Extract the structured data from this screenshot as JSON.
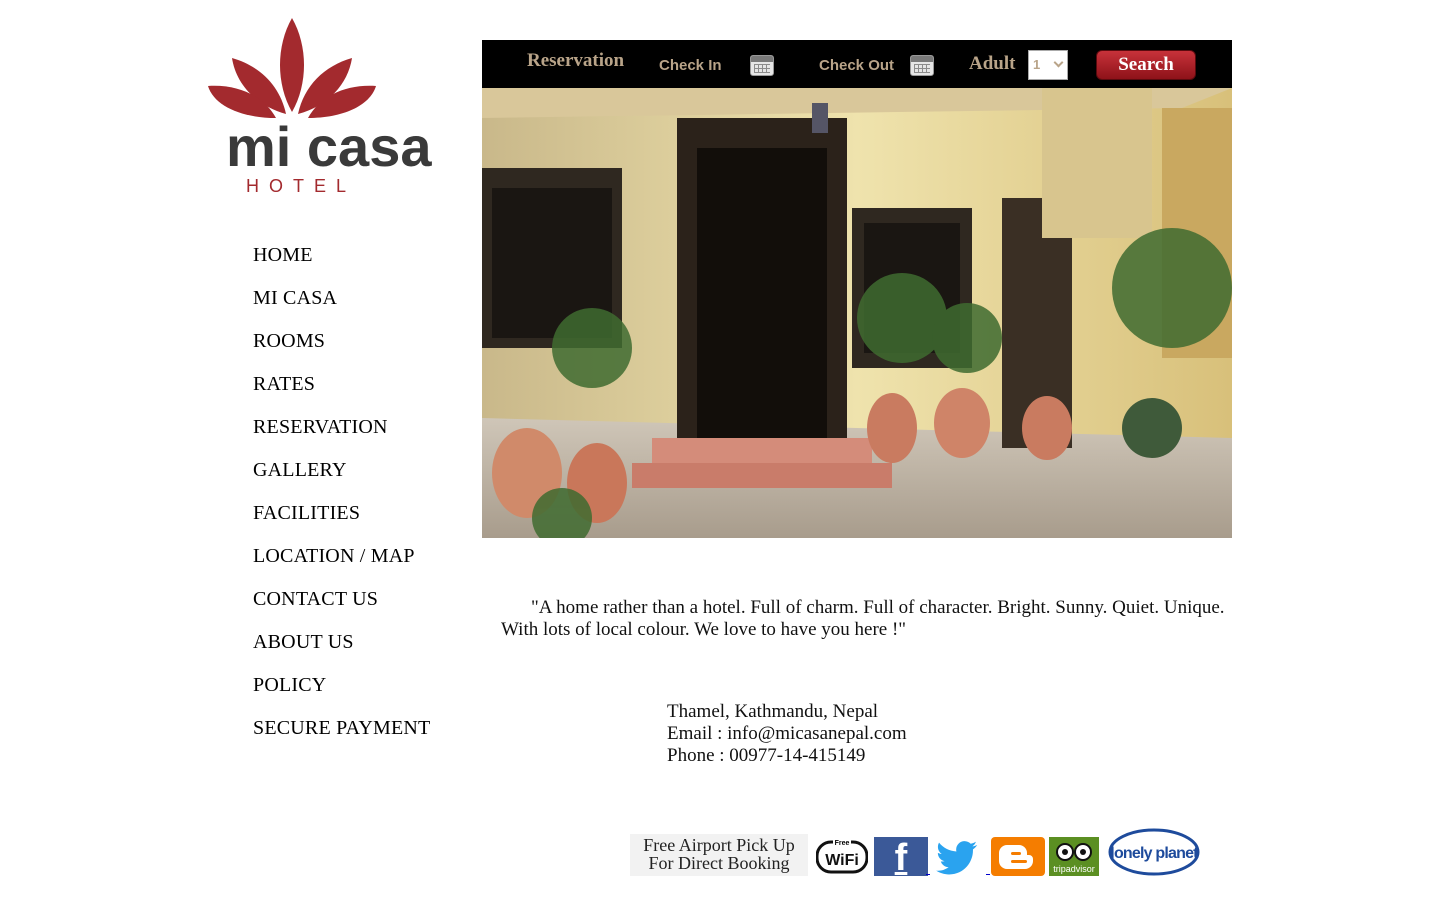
{
  "logo": {
    "word": "mi casa",
    "sub": "HOTEL",
    "brand_color": "#a32a2e"
  },
  "nav": {
    "items": [
      {
        "label": "HOME"
      },
      {
        "label": "MI CASA"
      },
      {
        "label": "ROOMS"
      },
      {
        "label": "RATES"
      },
      {
        "label": "RESERVATION"
      },
      {
        "label": "GALLERY"
      },
      {
        "label": "FACILITIES"
      },
      {
        "label": "LOCATION / MAP"
      },
      {
        "label": "CONTACT US"
      },
      {
        "label": "ABOUT US"
      },
      {
        "label": "POLICY"
      },
      {
        "label": "SECURE PAYMENT"
      }
    ]
  },
  "reservation": {
    "title": "Reservation",
    "check_in_label": "Check In",
    "check_out_label": "Check Out",
    "adult_label": "Adult",
    "adult_value": "1",
    "search_label": "Search",
    "label_color": "#b9a489",
    "button_color": "#b3222b"
  },
  "quote": {
    "text": "\"A home rather than a hotel. Full of charm. Full of character. Bright. Sunny. Quiet. Unique. With lots of local colour. We love to have you here !\""
  },
  "address": {
    "location": "Thamel, Kathmandu, Nepal",
    "email": "Email : info@micasanepal.com",
    "phone": "Phone : 00977-14-415149"
  },
  "badges": {
    "airport_line1": "Free Airport Pick Up",
    "airport_line2": "For Direct Booking",
    "wifi_top": "Free",
    "wifi": "WiFi",
    "facebook": "f",
    "tripadvisor": "tripadvisor",
    "lonely_planet": "lonely planet",
    "icons": [
      "wifi-icon",
      "facebook-icon",
      "twitter-icon",
      "blogger-icon",
      "tripadvisor-icon",
      "lonely-planet-icon"
    ]
  }
}
